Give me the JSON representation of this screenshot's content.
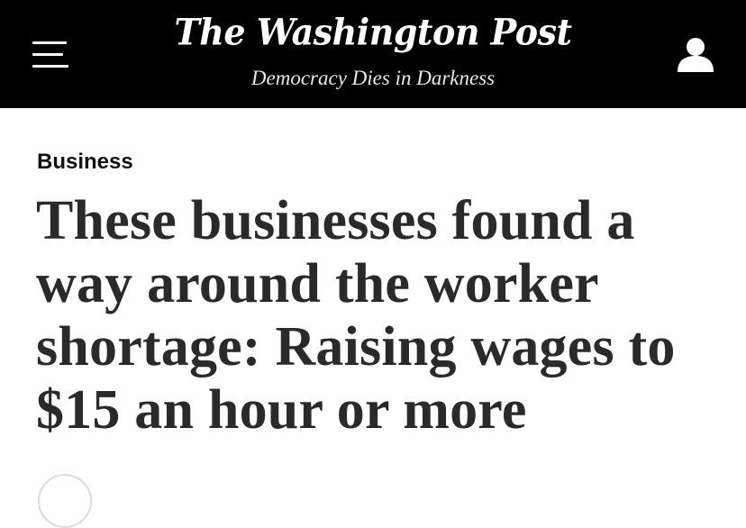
{
  "header": {
    "logo_text": "The Washington Post",
    "tagline": "Democracy Dies in Darkness",
    "menu_icon": "hamburger-menu-icon",
    "user_icon": "user-account-icon"
  },
  "article": {
    "section": "Business",
    "headline": "These businesses found a way around the worker shortage: Raising wages to $15 an hour or more"
  },
  "colors": {
    "header_bg": "#000000",
    "header_text": "#ffffff",
    "headline_text": "#2a2a2a"
  }
}
